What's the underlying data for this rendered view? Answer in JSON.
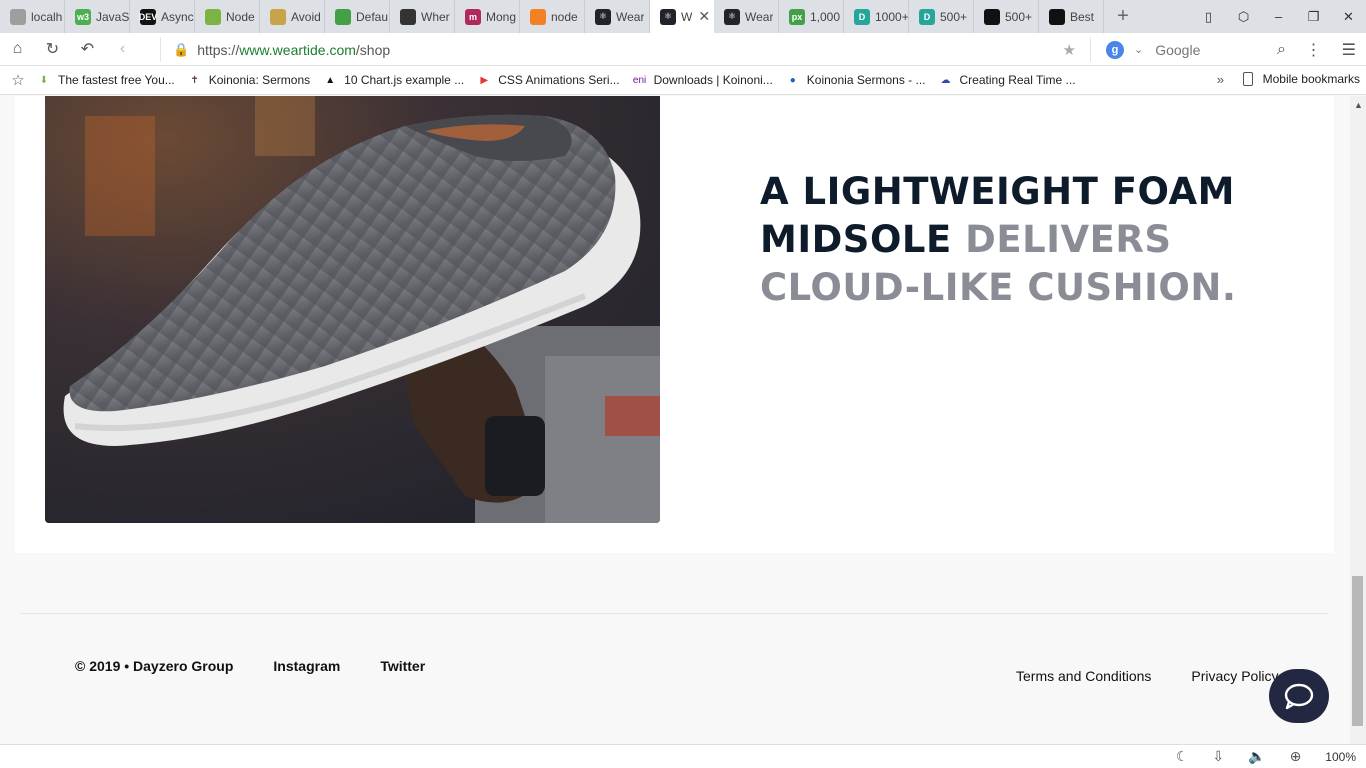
{
  "browser": {
    "tabs": [
      {
        "title": "localh",
        "icon": "page-icon",
        "color": "#9e9e9e",
        "glyph": ""
      },
      {
        "title": "JavaS",
        "icon": "w3schools-icon",
        "color": "#4caf50",
        "glyph": "w3"
      },
      {
        "title": "Async",
        "icon": "dev-icon",
        "color": "#111111",
        "glyph": "DEV"
      },
      {
        "title": "Node",
        "icon": "node-icon",
        "color": "#7cb342",
        "glyph": ""
      },
      {
        "title": "Avoid",
        "icon": "sun-icon",
        "color": "#c9a34a",
        "glyph": ""
      },
      {
        "title": "Defau",
        "icon": "shield-icon",
        "color": "#43a047",
        "glyph": ""
      },
      {
        "title": "Wher",
        "icon": "pen-icon",
        "color": "#333333",
        "glyph": ""
      },
      {
        "title": "Mong",
        "icon": "medium-icon",
        "color": "#b0285c",
        "glyph": "m"
      },
      {
        "title": "node",
        "icon": "stackoverflow-icon",
        "color": "#f48024",
        "glyph": ""
      },
      {
        "title": "Wear",
        "icon": "react-icon",
        "color": "#20232a",
        "glyph": "⚛"
      },
      {
        "title": "W",
        "icon": "react-icon",
        "color": "#20232a",
        "glyph": "⚛",
        "active": true
      },
      {
        "title": "Wear",
        "icon": "react-icon",
        "color": "#20232a",
        "glyph": "⚛"
      },
      {
        "title": "1,000",
        "icon": "px-icon",
        "color": "#43a047",
        "glyph": "px"
      },
      {
        "title": "1000+",
        "icon": "d-icon",
        "color": "#26a69a",
        "glyph": "D"
      },
      {
        "title": "500+",
        "icon": "d-icon",
        "color": "#26a69a",
        "glyph": "D"
      },
      {
        "title": "500+",
        "icon": "unsplash-icon",
        "color": "#111111",
        "glyph": ""
      },
      {
        "title": "Best",
        "icon": "unsplash-icon",
        "color": "#111111",
        "glyph": ""
      }
    ],
    "url_scheme": "https://",
    "url_host": "www.weartide.com",
    "url_path": "/shop",
    "search_placeholder": "Google",
    "bookmarks": [
      {
        "label": "The fastest free You...",
        "icon": "download-arrow-icon",
        "color": "#7cb342",
        "glyph": "⬇"
      },
      {
        "label": "Koinonia: Sermons",
        "icon": "cross-icon",
        "color": "#5d4037",
        "glyph": "✝"
      },
      {
        "label": "10 Chart.js example ...",
        "icon": "tutsplus-icon",
        "color": "#111111",
        "glyph": "▲"
      },
      {
        "label": "CSS Animations Seri...",
        "icon": "youtube-icon",
        "color": "#e53935",
        "glyph": "▶"
      },
      {
        "label": "Downloads | Koinoni...",
        "icon": "eni-icon",
        "color": "#6a1b9a",
        "glyph": "eni"
      },
      {
        "label": "Koinonia Sermons - ...",
        "icon": "globe-icon",
        "color": "#1565c0",
        "glyph": "●"
      },
      {
        "label": "Creating Real Time ...",
        "icon": "cloud-icon",
        "color": "#3949ab",
        "glyph": "☁"
      }
    ],
    "mobile_bookmarks": "Mobile bookmarks",
    "zoom": "100%"
  },
  "product": {
    "headline_dark": "A LIGHTWEIGHT FOAM MIDSOLE",
    "headline_muted": "DELIVERS CLOUD-LIKE CUSHION."
  },
  "footer": {
    "copyright": "© 2019 • Dayzero Group",
    "instagram": "Instagram",
    "twitter": "Twitter",
    "terms": "Terms and Conditions",
    "privacy": "Privacy Policy"
  }
}
